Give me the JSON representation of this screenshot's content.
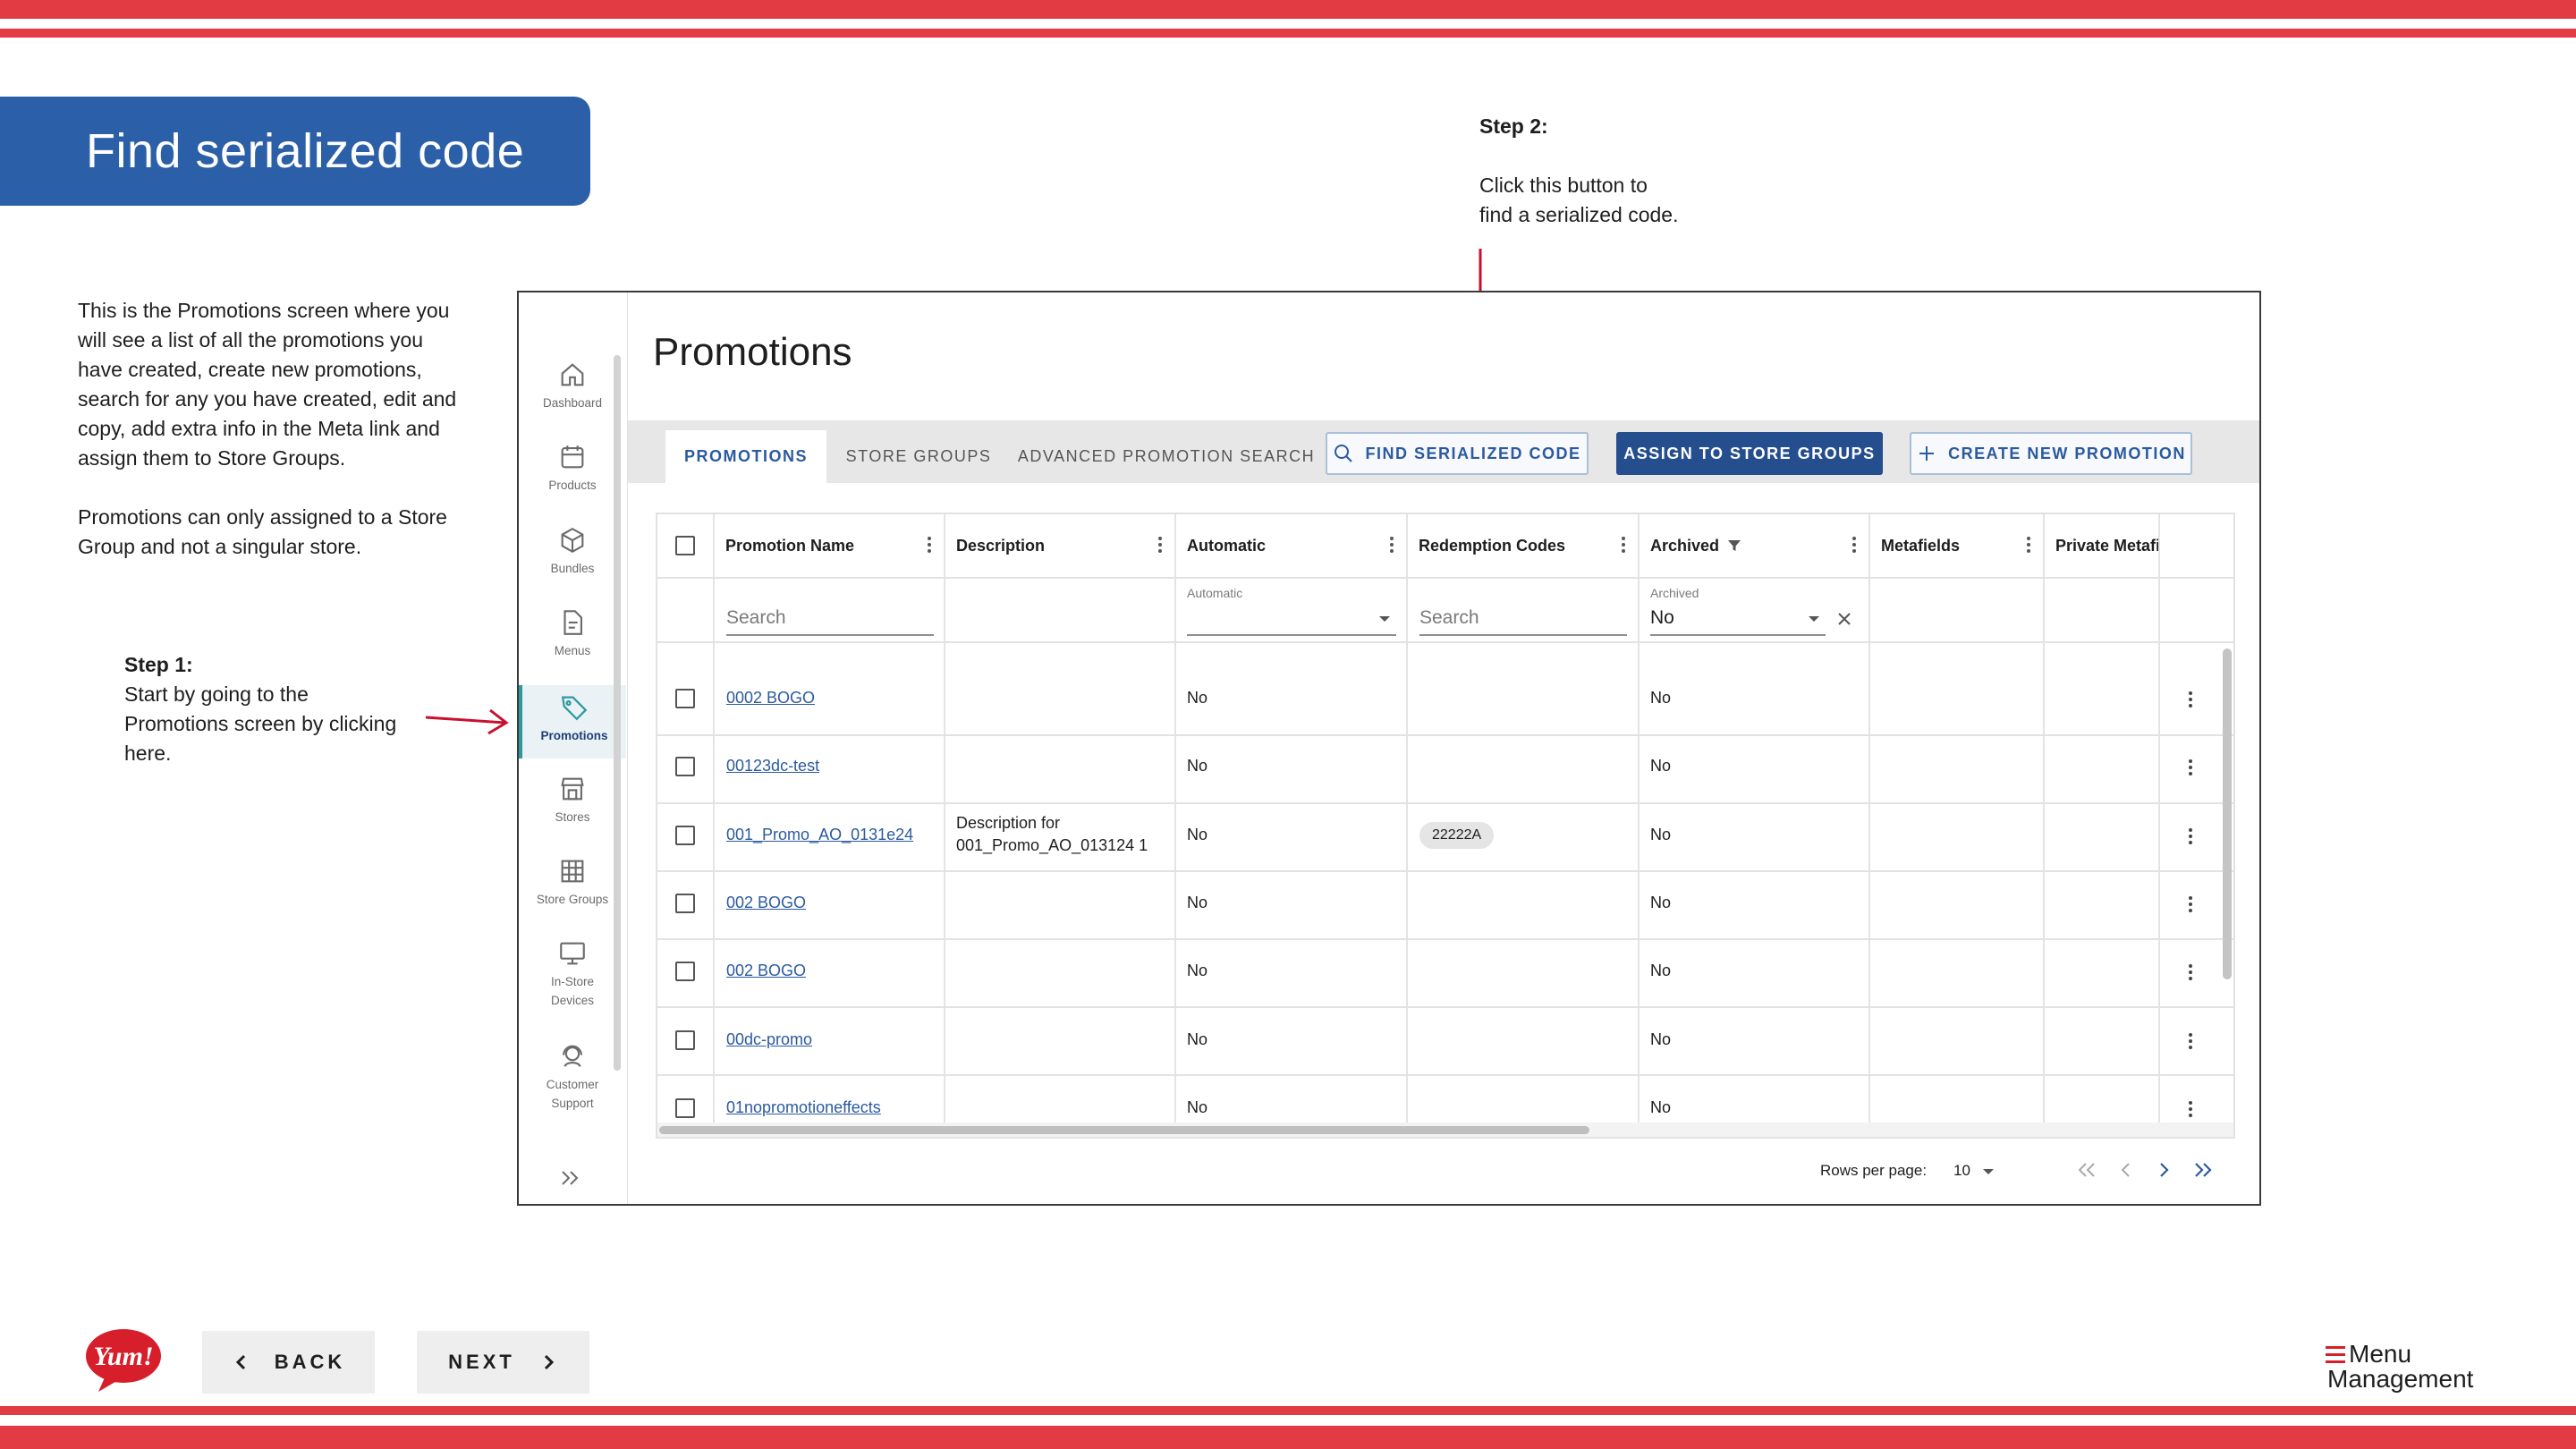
{
  "slide": {
    "title": "Find serialized code",
    "intro": "This is the Promotions screen where you\nwill see a list of all the promotions you\nhave created, create new promotions,\nsearch for any you have created, edit and\ncopy, add extra info in the Meta link and\nassign them to Store Groups.",
    "note": "Promotions can only assigned to a Store\nGroup and not a singular store.",
    "step1_head": "Step 1:",
    "step1_body": "Start by going to the\nPromotions screen by clicking\nhere.",
    "step2_head": "Step 2:",
    "step2_body": "Click this button to\nfind a serialized code.",
    "back_label": "BACK",
    "next_label": "NEXT",
    "logo_text": "Yum!",
    "brand_line1": "Menu",
    "brand_line2": "Management",
    "colors": {
      "stripe": "#e23b44",
      "banner": "#2b5fa8",
      "accent": "#244e8e",
      "link": "#2b5aa0"
    }
  },
  "app": {
    "page_title": "Promotions",
    "sidebar": [
      {
        "label": "Dashboard",
        "icon": "home-icon"
      },
      {
        "label": "Products",
        "icon": "calendar-icon"
      },
      {
        "label": "Bundles",
        "icon": "cube-icon"
      },
      {
        "label": "Menus",
        "icon": "document-icon"
      },
      {
        "label": "Promotions",
        "icon": "tag-icon",
        "active": true
      },
      {
        "label": "Stores",
        "icon": "storefront-icon"
      },
      {
        "label": "Store Groups",
        "icon": "grid-icon"
      },
      {
        "label": "In-Store\nDevices",
        "icon": "monitor-icon"
      },
      {
        "label": "Customer\nSupport",
        "icon": "headset-icon"
      }
    ],
    "tabs": [
      {
        "label": "PROMOTIONS",
        "active": true
      },
      {
        "label": "STORE GROUPS"
      },
      {
        "label": "ADVANCED PROMOTION SEARCH"
      }
    ],
    "buttons": {
      "find_serialized": "FIND SERIALIZED CODE",
      "assign_groups": "ASSIGN TO STORE GROUPS",
      "create_promotion": "CREATE NEW PROMOTION"
    },
    "columns": [
      "Promotion Name",
      "Description",
      "Automatic",
      "Redemption Codes",
      "Archived",
      "Metafields",
      "Private Metafi"
    ],
    "filters": {
      "name_placeholder": "Search",
      "automatic_label": "Automatic",
      "codes_placeholder": "Search",
      "archived_label": "Archived",
      "archived_value": "No"
    },
    "rows": [
      {
        "name": "0002 BOGO",
        "description": "",
        "automatic": "No",
        "codes": "",
        "archived": "No"
      },
      {
        "name": "00123dc-test",
        "description": "",
        "automatic": "No",
        "codes": "",
        "archived": "No"
      },
      {
        "name": "001_Promo_AO_0131e24",
        "description": "Description for\n001_Promo_AO_013124 1",
        "automatic": "No",
        "codes": "22222A",
        "archived": "No"
      },
      {
        "name": "002 BOGO",
        "description": "",
        "automatic": "No",
        "codes": "",
        "archived": "No"
      },
      {
        "name": "002 BOGO",
        "description": "",
        "automatic": "No",
        "codes": "",
        "archived": "No"
      },
      {
        "name": "00dc-promo",
        "description": "",
        "automatic": "No",
        "codes": "",
        "archived": "No"
      },
      {
        "name": "01nopromotioneffects",
        "description": "",
        "automatic": "No",
        "codes": "",
        "archived": "No"
      }
    ],
    "pagination": {
      "rows_per_page_label": "Rows per page:",
      "rows_per_page": "10"
    }
  }
}
